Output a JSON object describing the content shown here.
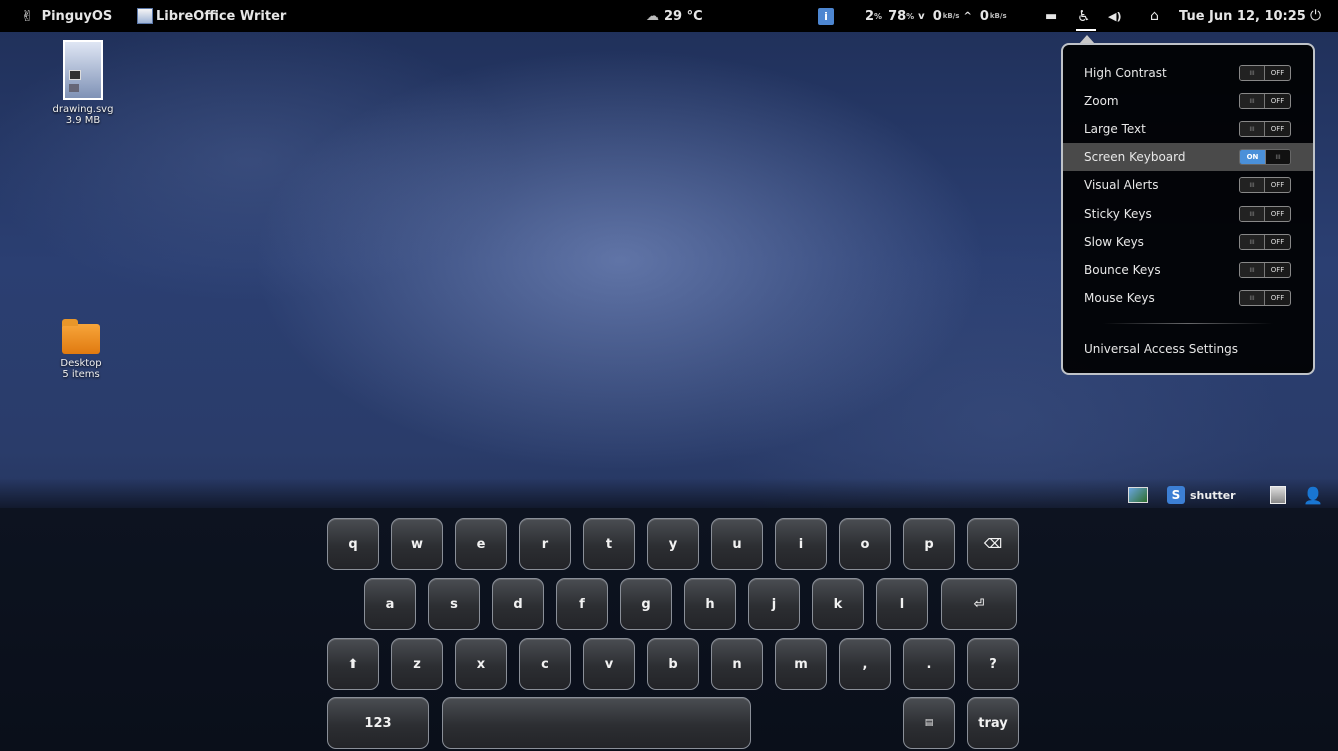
{
  "top_panel": {
    "activities_icon": "✌",
    "activities_label": "PinguyOS",
    "app_icon": "libreoffice-writer-icon",
    "app_label": "LibreOffice Writer",
    "weather_icon": "☁",
    "weather": "29 °C",
    "info_icon": "i",
    "cpu": "2",
    "mem": "78",
    "percent": "%",
    "net_down": "0",
    "net_up": "0",
    "net_unit": "kB/s",
    "down_arrow": "v",
    "up_arrow": "^",
    "files_icon": "▬",
    "a11y_icon": "♿",
    "volume_icon": "◀)",
    "network_icon": "⌂",
    "datetime": "Tue Jun 12, 10:25",
    "power_icon": "⏻"
  },
  "desktop": {
    "icons": [
      {
        "name": "drawing.svg",
        "meta": "3.9 MB"
      },
      {
        "name": "Desktop",
        "meta": "5 items"
      }
    ]
  },
  "a11y_menu": {
    "items": [
      {
        "label": "High Contrast",
        "state": "OFF",
        "on": false
      },
      {
        "label": "Zoom",
        "state": "OFF",
        "on": false
      },
      {
        "label": "Large Text",
        "state": "OFF",
        "on": false
      },
      {
        "label": "Screen Keyboard",
        "state": "ON",
        "on": true
      },
      {
        "label": "Visual Alerts",
        "state": "OFF",
        "on": false
      },
      {
        "label": "Sticky Keys",
        "state": "OFF",
        "on": false
      },
      {
        "label": "Slow Keys",
        "state": "OFF",
        "on": false
      },
      {
        "label": "Bounce Keys",
        "state": "OFF",
        "on": false
      },
      {
        "label": "Mouse Keys",
        "state": "OFF",
        "on": false
      }
    ],
    "settings_label": "Universal Access Settings",
    "grip": "III"
  },
  "tray": {
    "shutter_label": "shutter",
    "shutter_icon": "S",
    "user_icon": "👤"
  },
  "keyboard": {
    "row1": [
      "q",
      "w",
      "e",
      "r",
      "t",
      "y",
      "u",
      "i",
      "o",
      "p",
      "⌫"
    ],
    "row2": [
      "a",
      "s",
      "d",
      "f",
      "g",
      "h",
      "j",
      "k",
      "l",
      "⏎"
    ],
    "row3": [
      "⬆",
      "z",
      "x",
      "c",
      "v",
      "b",
      "n",
      "m",
      ",",
      ".",
      "?"
    ],
    "row4": {
      "numbers": "123",
      "space": "",
      "layout": "▤",
      "tray": "tray"
    }
  }
}
